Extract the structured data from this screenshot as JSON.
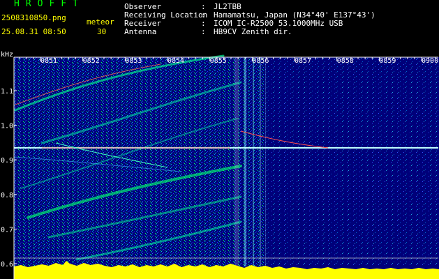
{
  "header": {
    "app_title": "HROFFT",
    "file_name": "2508310850.png",
    "date_time": "25.08.31 08:50",
    "meteor_label": "meteor",
    "meteor_count": "30",
    "info": [
      {
        "label": "Observer",
        "value": "JL2TBB"
      },
      {
        "label": "Receiving Location",
        "value": "Hamamatsu, Japan (N34°40' E137°43')"
      },
      {
        "label": "Receiver",
        "value": "ICOM IC-R2500 53.1000MHz USB"
      },
      {
        "label": "Antenna",
        "value": "HB9CV Zenith dir."
      }
    ]
  },
  "spectrogram": {
    "y_unit": "kHz",
    "y_ticks": [
      "1.1",
      "1.0",
      "0.9",
      "0.8",
      "0.7",
      "0.6"
    ],
    "x_ticks": [
      "0851",
      "0852",
      "0853",
      "0854",
      "0855",
      "0856",
      "0857",
      "0858",
      "0859",
      "0900"
    ],
    "colors": {
      "background": "#00007a",
      "noise_low": "#1a3cff",
      "noise_mid": "#00c8c8",
      "noise_high": "#00ff66",
      "signal": "#ff4040",
      "level": "#ffff00",
      "axis": "#ffffff"
    }
  }
}
